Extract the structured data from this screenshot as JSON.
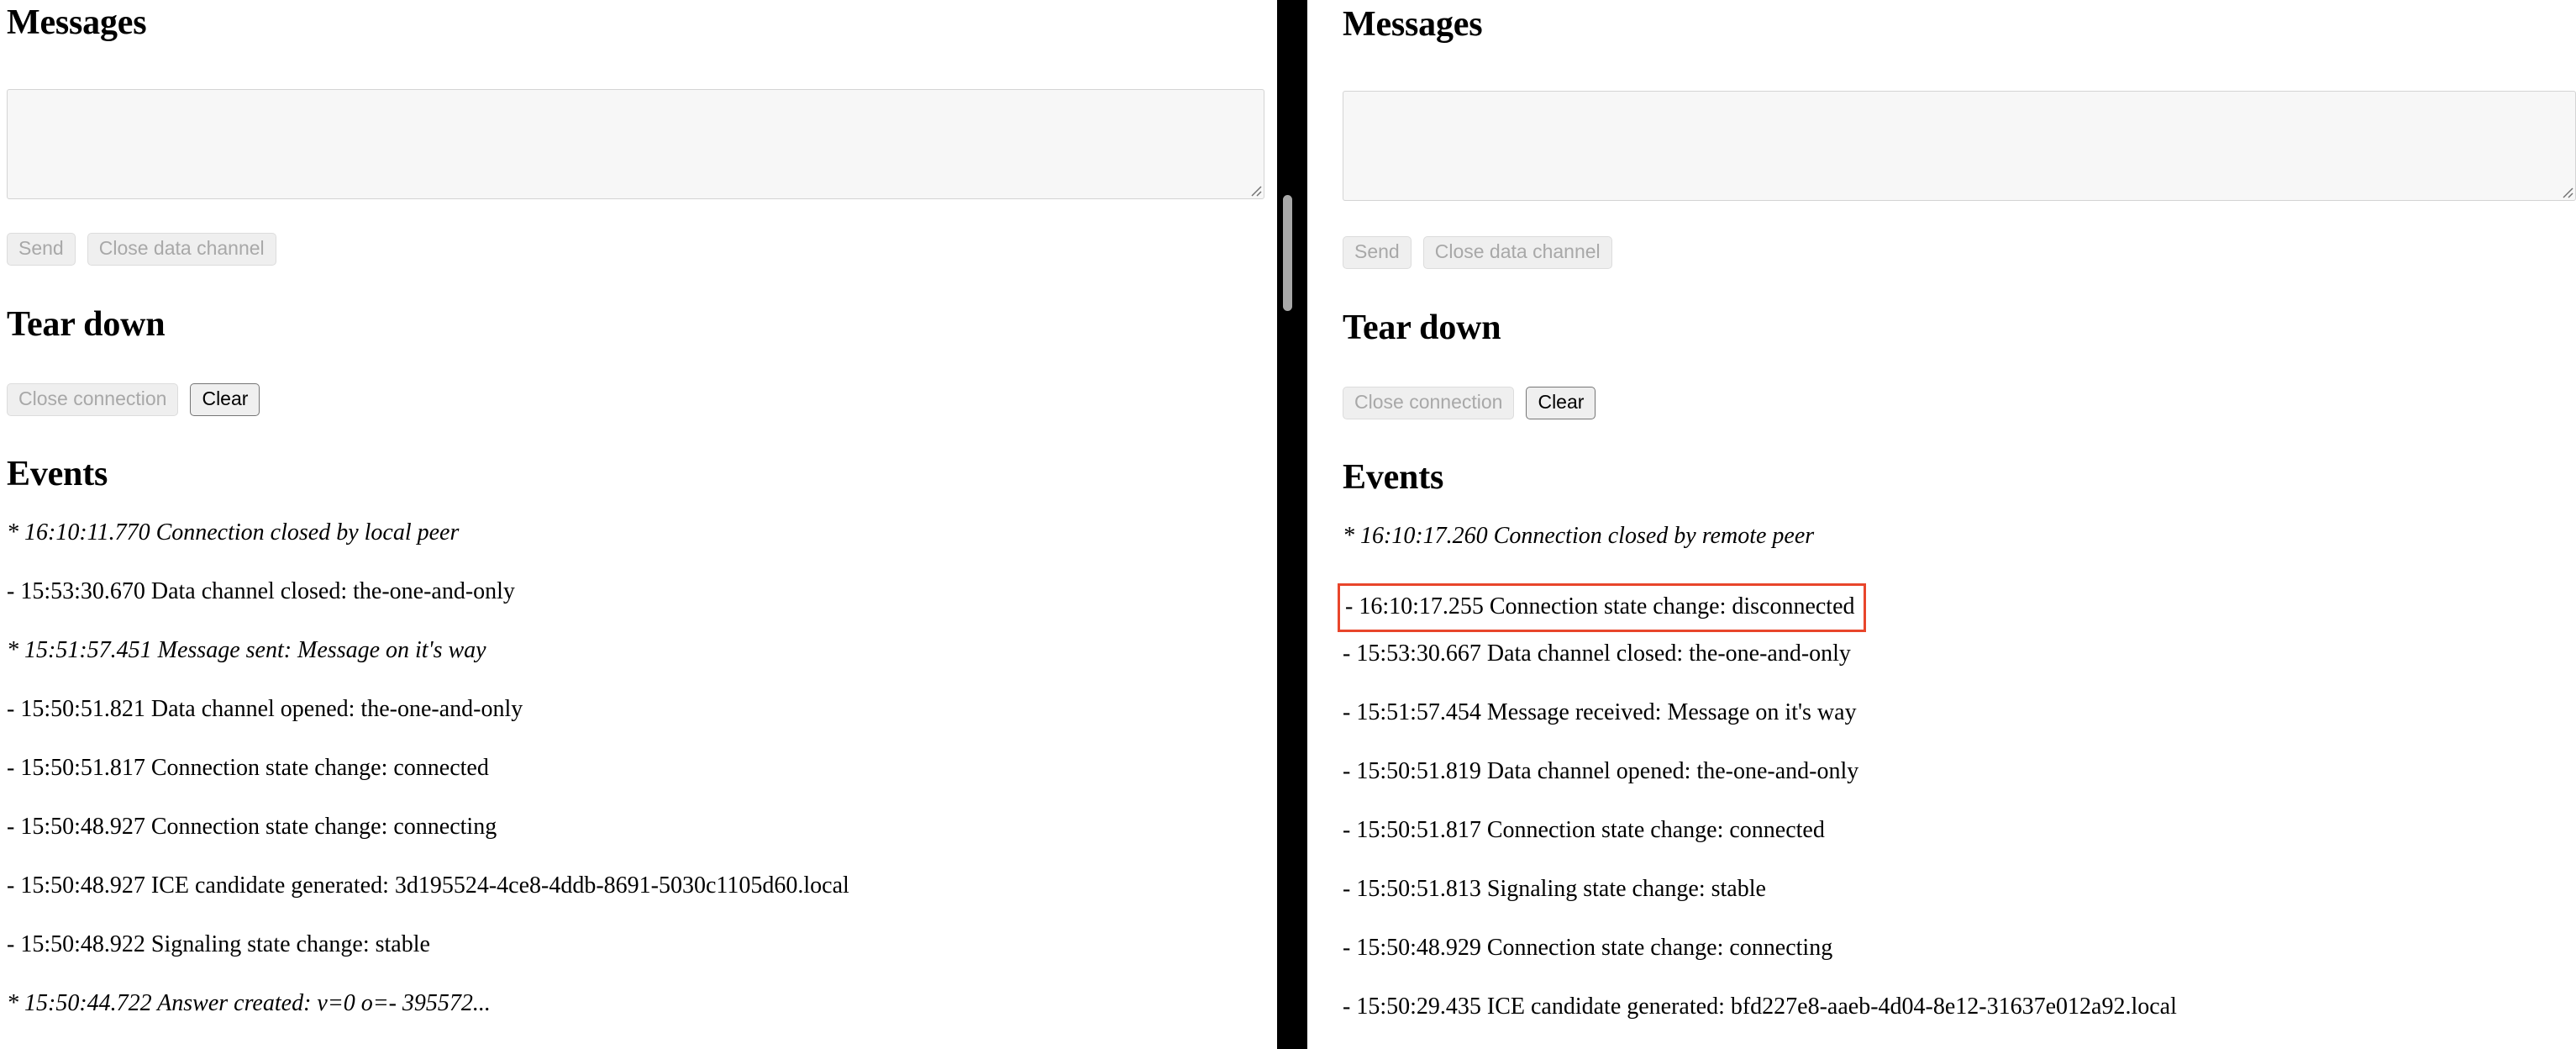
{
  "divider": {
    "color": "#000000",
    "scrollbar_thumb_color": "#a8a8a8"
  },
  "highlight": {
    "color": "#e8452b"
  },
  "panels": [
    {
      "id": "left-peer",
      "messages": {
        "title": "Messages",
        "textarea_value": "",
        "textarea_placeholder": "",
        "send_label": "Send",
        "send_disabled": true,
        "close_channel_label": "Close data channel",
        "close_channel_disabled": true
      },
      "teardown": {
        "title": "Tear down",
        "close_connection_label": "Close connection",
        "close_connection_disabled": true,
        "clear_label": "Clear",
        "clear_disabled": false
      },
      "events": {
        "title": "Events",
        "items": [
          {
            "marker": "*",
            "text": "16:10:11.770 Connection closed by local peer",
            "style": "italic",
            "highlighted": false
          },
          {
            "marker": "-",
            "text": "15:53:30.670 Data channel closed: the-one-and-only",
            "style": "normal",
            "highlighted": false
          },
          {
            "marker": "*",
            "text": "15:51:57.451 Message sent: Message on it's way",
            "style": "italic",
            "highlighted": false
          },
          {
            "marker": "-",
            "text": "15:50:51.821 Data channel opened: the-one-and-only",
            "style": "normal",
            "highlighted": false
          },
          {
            "marker": "-",
            "text": "15:50:51.817 Connection state change: connected",
            "style": "normal",
            "highlighted": false
          },
          {
            "marker": "-",
            "text": "15:50:48.927 Connection state change: connecting",
            "style": "normal",
            "highlighted": false
          },
          {
            "marker": "-",
            "text": "15:50:48.927 ICE candidate generated: 3d195524-4ce8-4ddb-8691-5030c1105d60.local",
            "style": "normal",
            "highlighted": false
          },
          {
            "marker": "-",
            "text": "15:50:48.922 Signaling state change: stable",
            "style": "normal",
            "highlighted": false
          },
          {
            "marker": "*",
            "text": "15:50:44.722 Answer created: v=0 o=- 395572...",
            "style": "italic",
            "highlighted": false
          }
        ]
      }
    },
    {
      "id": "right-peer",
      "messages": {
        "title": "Messages",
        "textarea_value": "",
        "textarea_placeholder": "",
        "send_label": "Send",
        "send_disabled": true,
        "close_channel_label": "Close data channel",
        "close_channel_disabled": true
      },
      "teardown": {
        "title": "Tear down",
        "close_connection_label": "Close connection",
        "close_connection_disabled": true,
        "clear_label": "Clear",
        "clear_disabled": false
      },
      "events": {
        "title": "Events",
        "items": [
          {
            "marker": "*",
            "text": "16:10:17.260 Connection closed by remote peer",
            "style": "italic",
            "highlighted": false
          },
          {
            "marker": "-",
            "text": "16:10:17.255 Connection state change: disconnected",
            "style": "normal",
            "highlighted": true
          },
          {
            "marker": "-",
            "text": "15:53:30.667 Data channel closed: the-one-and-only",
            "style": "normal",
            "highlighted": false
          },
          {
            "marker": "-",
            "text": "15:51:57.454 Message received: Message on it's way",
            "style": "normal",
            "highlighted": false
          },
          {
            "marker": "-",
            "text": "15:50:51.819 Data channel opened: the-one-and-only",
            "style": "normal",
            "highlighted": false
          },
          {
            "marker": "-",
            "text": "15:50:51.817 Connection state change: connected",
            "style": "normal",
            "highlighted": false
          },
          {
            "marker": "-",
            "text": "15:50:51.813 Signaling state change: stable",
            "style": "normal",
            "highlighted": false
          },
          {
            "marker": "-",
            "text": "15:50:48.929 Connection state change: connecting",
            "style": "normal",
            "highlighted": false
          },
          {
            "marker": "-",
            "text": "15:50:29.435 ICE candidate generated: bfd227e8-aaeb-4d04-8e12-31637e012a92.local",
            "style": "normal",
            "highlighted": false
          }
        ]
      }
    }
  ]
}
